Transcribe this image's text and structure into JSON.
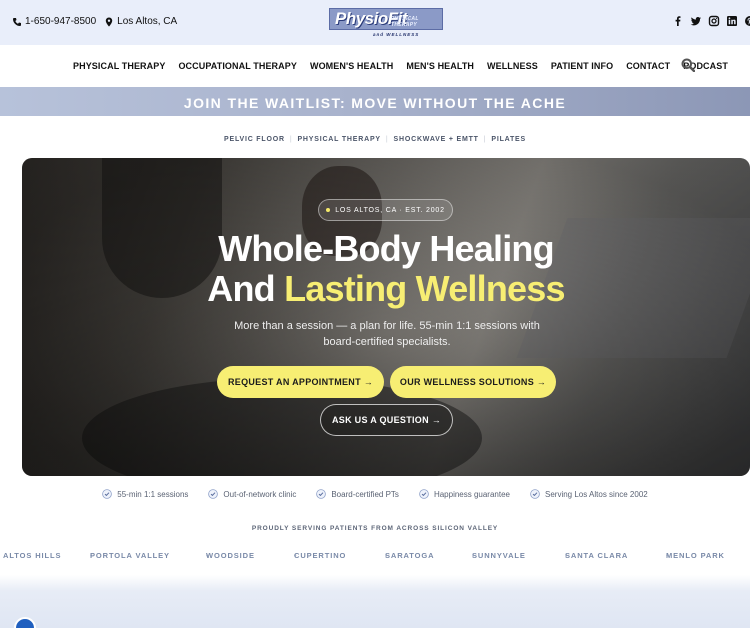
{
  "topbar": {
    "phone": "1-650-947-8500",
    "location": "Los Altos, CA",
    "phone_icon": "phone-icon",
    "location_icon": "map-pin-icon"
  },
  "logo": {
    "main": "PhysioFit",
    "tag": "PHYSICAL THERAPY",
    "sub": "and WELLNESS"
  },
  "social": [
    "facebook-icon",
    "twitter-icon",
    "instagram-icon",
    "linkedin-icon",
    "pinterest-icon"
  ],
  "nav": {
    "items": [
      "PHYSICAL THERAPY",
      "OCCUPATIONAL THERAPY",
      "WOMEN'S HEALTH",
      "MEN'S HEALTH",
      "WELLNESS",
      "PATIENT INFO",
      "CONTACT",
      "PODCAST"
    ],
    "search_icon": "search-icon"
  },
  "banner": {
    "text": "JOIN THE WAITLIST: MOVE WITHOUT THE ACHE"
  },
  "categories": [
    "PELVIC FLOOR",
    "PHYSICAL THERAPY",
    "SHOCKWAVE + EMTT",
    "PILATES"
  ],
  "hero": {
    "pill": "LOS ALTOS, CA · EST. 2002",
    "title_line1": "Whole-Body Healing",
    "title_line2_plain": "And ",
    "title_line2_highlight": "Lasting Wellness",
    "lede": "More than a session — a plan for life. 55-min 1:1 sessions with board-certified specialists.",
    "btn_appointment": "REQUEST AN APPOINTMENT →",
    "btn_solutions": "OUR WELLNESS SOLUTIONS →",
    "btn_question": "ASK US A QUESTION →"
  },
  "trust": [
    "55-min 1:1 sessions",
    "Out-of-network clinic",
    "Board-certified PTs",
    "Happiness guarantee",
    "Serving Los Altos since 2002"
  ],
  "serving_heading": "PROUDLY SERVING PATIENTS FROM ACROSS SILICON VALLEY",
  "towns": [
    "ALTOS HILLS",
    "PORTOLA VALLEY",
    "WOODSIDE",
    "CUPERTINO",
    "SARATOGA",
    "SUNNYVALE",
    "SANTA CLARA",
    "MENLO PARK"
  ],
  "colors": {
    "accent_yellow": "#f7ee73",
    "topbar_bg": "#e9eefa",
    "banner_bg": "#a9b3cd",
    "town_text": "#7a8aa8"
  }
}
